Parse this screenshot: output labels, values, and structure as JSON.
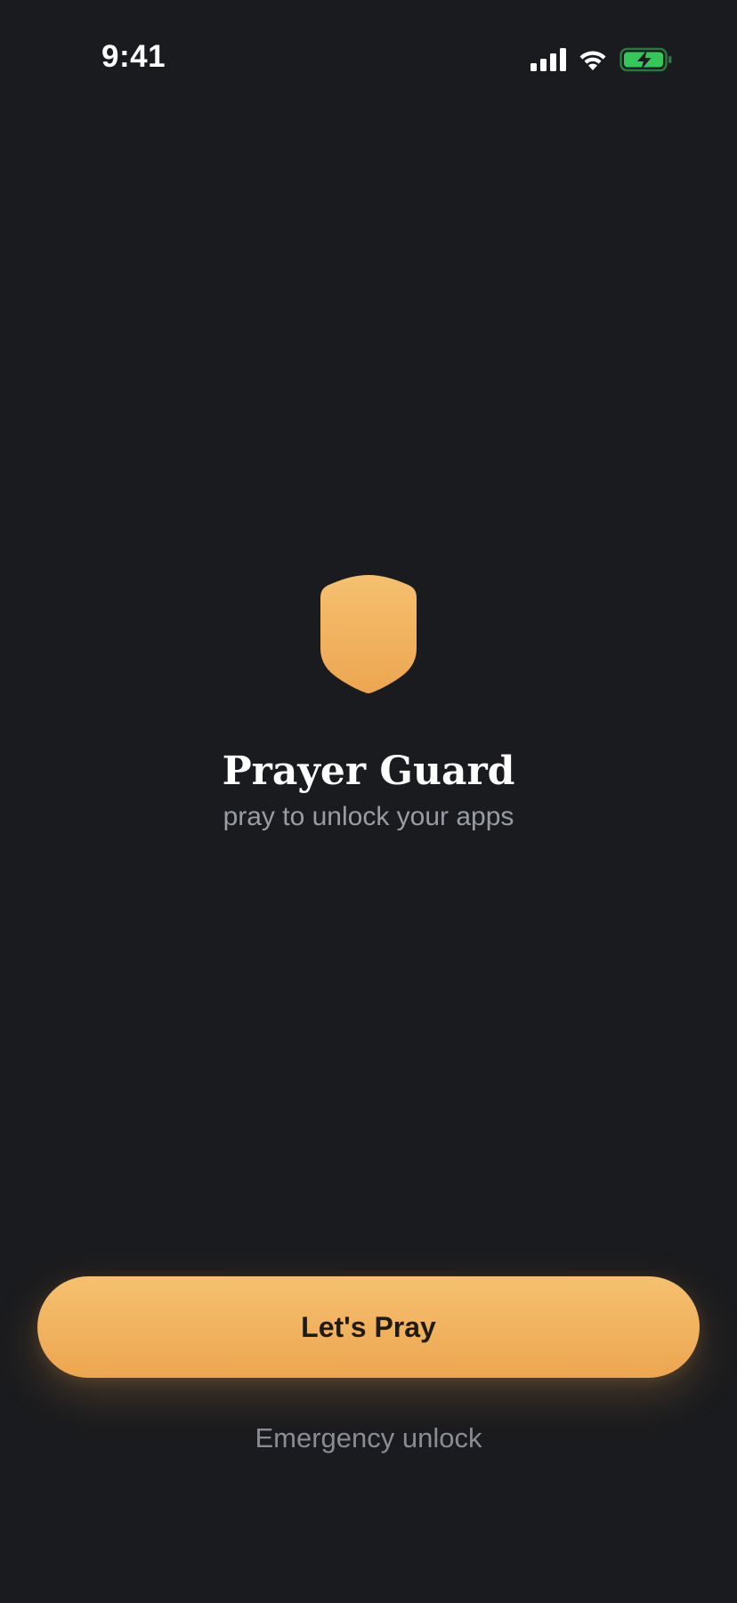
{
  "status_bar": {
    "time": "9:41",
    "icons": [
      "signal-icon",
      "wifi-icon",
      "battery-charging-icon"
    ],
    "battery_color": "#34c759"
  },
  "hero": {
    "icon": "shield-icon",
    "title": "Prayer Guard",
    "subtitle": "pray to unlock your apps"
  },
  "actions": {
    "primary_label": "Let's Pray",
    "secondary_label": "Emergency unlock"
  },
  "colors": {
    "background": "#1a1b1e",
    "accent_top": "#f5c070",
    "accent_bottom": "#eda650",
    "subtitle": "#9a9ca3",
    "secondary_text": "#8a8c93"
  }
}
